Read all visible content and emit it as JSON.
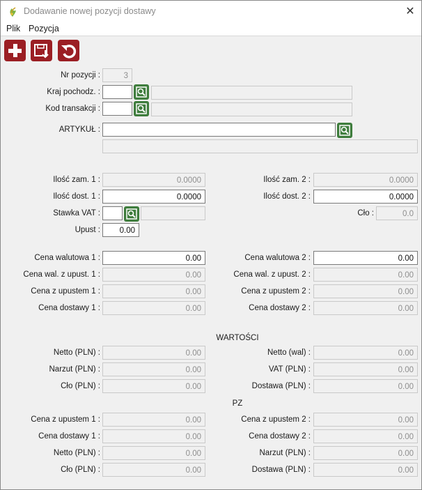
{
  "window": {
    "title": "Dodawanie nowej pozycji dostawy"
  },
  "menu": {
    "plik": "Plik",
    "pozycja": "Pozycja"
  },
  "header": {
    "nr_pozycji_label": "Nr pozycji :",
    "nr_pozycji_value": "3",
    "kraj_label": "Kraj pochodz. :",
    "kraj_value": "",
    "kraj_desc": "",
    "kod_label": "Kod transakcji :",
    "kod_value": "",
    "kod_desc": "",
    "artykul_label": "ARTYKUŁ :",
    "artykul_value": "",
    "artykul_desc": ""
  },
  "qty": {
    "ilosc_zam1_label": "Ilość zam. 1 :",
    "ilosc_zam1": "0.0000",
    "ilosc_zam2_label": "Ilość zam. 2 :",
    "ilosc_zam2": "0.0000",
    "ilosc_dost1_label": "Ilość dost. 1 :",
    "ilosc_dost1": "0.0000",
    "ilosc_dost2_label": "Ilość dost. 2 :",
    "ilosc_dost2": "0.0000",
    "stawka_vat_label": "Stawka VAT :",
    "stawka_vat": "",
    "stawka_vat_desc": "",
    "clo_label": "Cło :",
    "clo": "0.0",
    "upust_label": "Upust :",
    "upust": "0.00"
  },
  "prices": {
    "cena_wal1_label": "Cena walutowa 1 :",
    "cena_wal1": "0.00",
    "cena_wal2_label": "Cena walutowa 2 :",
    "cena_wal2": "0.00",
    "cena_wal_upust1_label": "Cena wal. z upust. 1 :",
    "cena_wal_upust1": "0.00",
    "cena_wal_upust2_label": "Cena wal. z upust. 2 :",
    "cena_wal_upust2": "0.00",
    "cena_upust1_label": "Cena z upustem 1 :",
    "cena_upust1": "0.00",
    "cena_upust2_label": "Cena z upustem 2 :",
    "cena_upust2": "0.00",
    "cena_dost1_label": "Cena dostawy 1 :",
    "cena_dost1": "0.00",
    "cena_dost2_label": "Cena dostawy 2 :",
    "cena_dost2": "0.00"
  },
  "wartosci": {
    "heading": "WARTOŚCI",
    "netto_pln_label": "Netto (PLN) :",
    "netto_pln": "0.00",
    "netto_wal_label": "Netto (wal) :",
    "netto_wal": "0.00",
    "narzut_pln_label": "Narzut (PLN) :",
    "narzut_pln": "0.00",
    "vat_pln_label": "VAT (PLN) :",
    "vat_pln": "0.00",
    "clo_pln_label": "Cło (PLN) :",
    "clo_pln": "0.00",
    "dostawa_pln_label": "Dostawa (PLN) :",
    "dostawa_pln": "0.00"
  },
  "pz": {
    "heading": "PZ",
    "cena_upust1_label": "Cena z upustem 1 :",
    "cena_upust1": "0.00",
    "cena_upust2_label": "Cena z upustem 2 :",
    "cena_upust2": "0.00",
    "cena_dost1_label": "Cena dostawy 1 :",
    "cena_dost1": "0.00",
    "cena_dost2_label": "Cena dostawy 2 :",
    "cena_dost2": "0.00",
    "netto_pln_label": "Netto (PLN) :",
    "netto_pln": "0.00",
    "narzut_pln_label": "Narzut (PLN) :",
    "narzut_pln": "0.00",
    "clo_pln_label": "Cło (PLN) :",
    "clo_pln": "0.00",
    "dostawa_pln_label": "Dostawa (PLN) :",
    "dostawa_pln": "0.00"
  },
  "toolbar": {
    "add_icon": "plus-icon",
    "save_icon": "save-icon",
    "undo_icon": "undo-icon"
  },
  "colors": {
    "toolbar_button": "#9b1f24",
    "search_button": "#3f7d3d",
    "window_bg": "#f0f0f0"
  }
}
